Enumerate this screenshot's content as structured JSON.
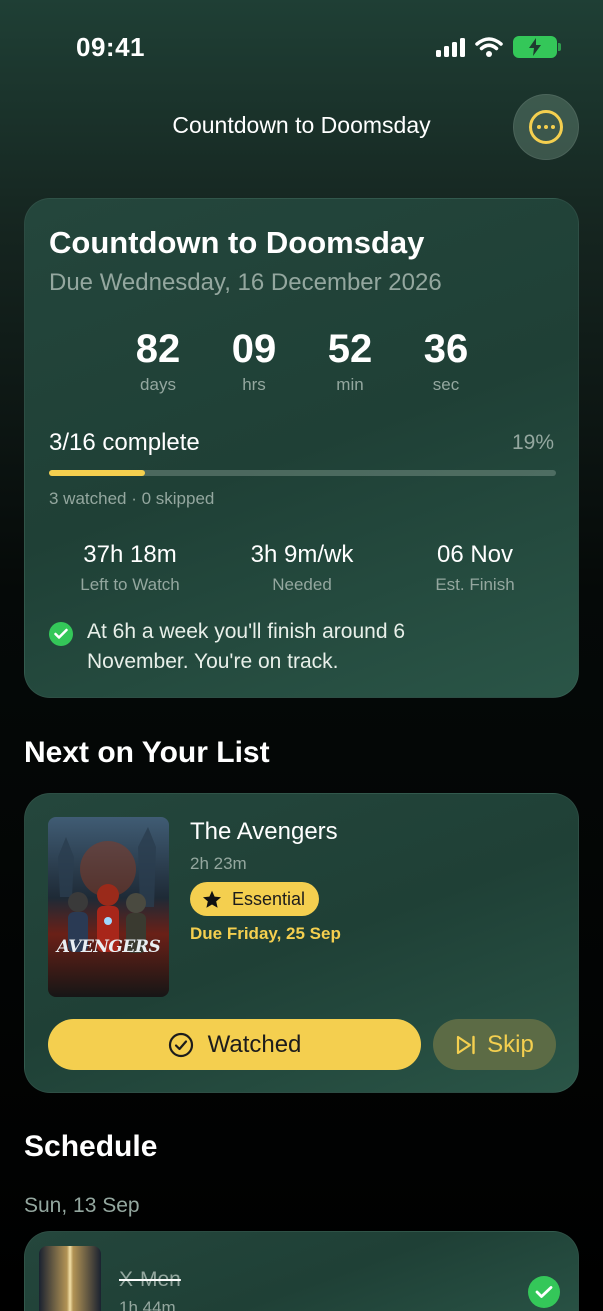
{
  "status_bar": {
    "time": "09:41"
  },
  "header": {
    "title": "Countdown to Doomsday",
    "more_icon": "ellipsis-circle-icon"
  },
  "countdown_card": {
    "title": "Countdown to Doomsday",
    "due": "Due Wednesday, 16 December 2026",
    "units": [
      {
        "value": "82",
        "label": "days"
      },
      {
        "value": "09",
        "label": "hrs"
      },
      {
        "value": "52",
        "label": "min"
      },
      {
        "value": "36",
        "label": "sec"
      }
    ],
    "progress": {
      "label": "3/16 complete",
      "percent_text": "19%",
      "fraction": 0.19
    },
    "progress_sub": "3 watched · 0 skipped",
    "stats": [
      {
        "value": "37h 18m",
        "label": "Left to Watch"
      },
      {
        "value": "3h 9m/wk",
        "label": "Needed"
      },
      {
        "value": "06 Nov",
        "label": "Est. Finish"
      }
    ],
    "note": "At 6h a week you'll finish around 6 November. You're on track."
  },
  "next_section": {
    "title": "Next on Your List",
    "movie": {
      "title": "The Avengers",
      "duration": "2h 23m",
      "badge": "Essential",
      "due": "Due Friday, 25 Sep",
      "poster_text": "AVENGERS"
    },
    "watched_label": "Watched",
    "skip_label": "Skip"
  },
  "schedule": {
    "title": "Schedule",
    "day": "Sun, 13 Sep",
    "items": [
      {
        "title": "X-Men",
        "duration": "1h 44m",
        "watched": true
      }
    ]
  },
  "colors": {
    "accent": "#f4cf4f",
    "success": "#34c759",
    "muted": "#94a79f"
  }
}
